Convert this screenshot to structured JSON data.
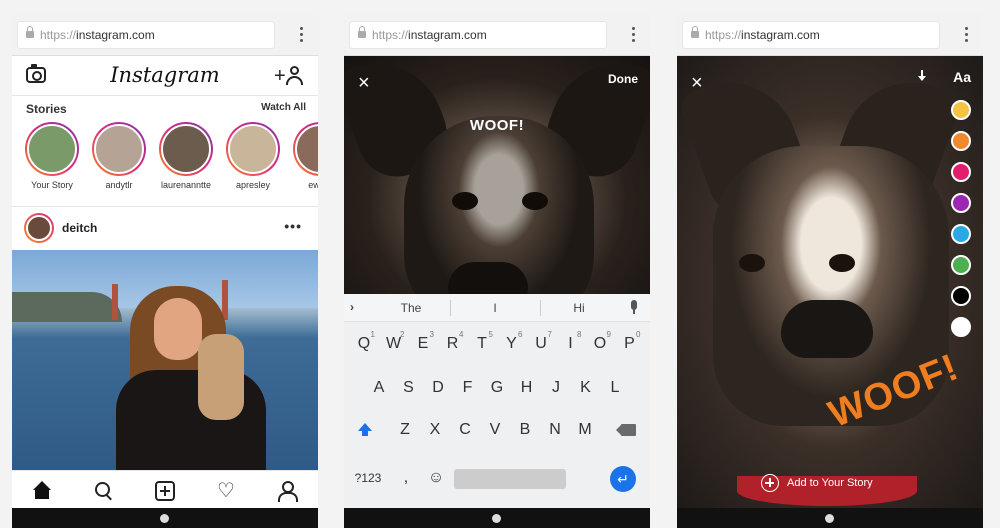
{
  "browser": {
    "scheme": "https://",
    "host": "instagram.com"
  },
  "feed": {
    "logo": "Instagram",
    "stories_title": "Stories",
    "watch_all": "Watch All",
    "stories": [
      {
        "label": "Your Story",
        "color": "#7a9a6a"
      },
      {
        "label": "andytlr",
        "color": "#b5a496"
      },
      {
        "label": "laurenanntte",
        "color": "#6b5c4e"
      },
      {
        "label": "apresley",
        "color": "#c9b59a"
      },
      {
        "label": "ewths",
        "color": "#8a6a5a"
      }
    ],
    "post_user": "deitch",
    "post_more": "•••"
  },
  "editor": {
    "close": "×",
    "done": "Done",
    "text_overlay": "WOOF!",
    "suggestions": [
      "The",
      "I",
      "Hi"
    ],
    "keyboard": {
      "row1": [
        {
          "k": "Q",
          "n": "1"
        },
        {
          "k": "W",
          "n": "2"
        },
        {
          "k": "E",
          "n": "3"
        },
        {
          "k": "R",
          "n": "4"
        },
        {
          "k": "T",
          "n": "5"
        },
        {
          "k": "Y",
          "n": "6"
        },
        {
          "k": "U",
          "n": "7"
        },
        {
          "k": "I",
          "n": "8"
        },
        {
          "k": "O",
          "n": "9"
        },
        {
          "k": "P",
          "n": "0"
        }
      ],
      "row2": [
        "A",
        "S",
        "D",
        "F",
        "G",
        "H",
        "J",
        "K",
        "L"
      ],
      "row3": [
        "Z",
        "X",
        "C",
        "V",
        "B",
        "N",
        "M"
      ],
      "symbols": "?123",
      "comma": ",",
      "emoji": "☺",
      "enter": "↵"
    }
  },
  "story": {
    "close": "×",
    "aa": "Aa",
    "woof": "WOOF!",
    "add_to_story": "Add to Your Story",
    "swatches": [
      "#f5c242",
      "#f0892e",
      "#e21d6b",
      "#9c27b0",
      "#2aa8e6",
      "#4caf50",
      "#000000",
      "#ffffff"
    ]
  }
}
